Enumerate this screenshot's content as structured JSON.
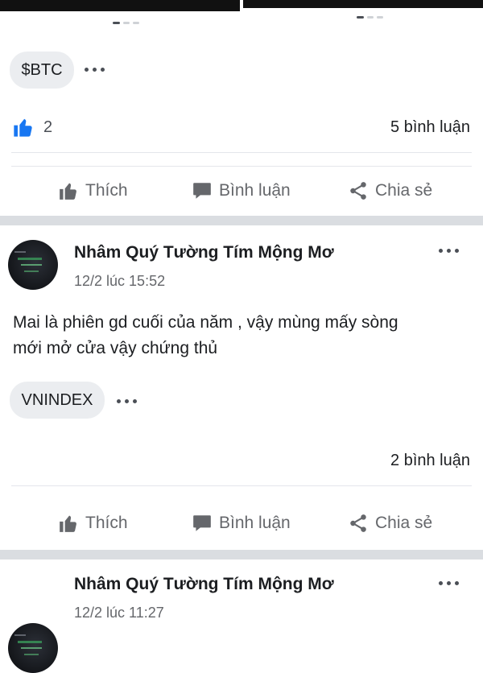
{
  "post1": {
    "tag": "$BTC",
    "like_count": "2",
    "comment_count": "5 bình luận"
  },
  "actions": {
    "like": "Thích",
    "comment": "Bình luận",
    "share": "Chia sẻ"
  },
  "post2": {
    "author": "Nhâm Quý Tường Tím Mộng Mơ",
    "timestamp": "12/2 lúc 15:52",
    "text_line1": "Mai là phiên gd cuối của năm , vậy mùng mấy sòng",
    "text_line2": "mới mở cửa vậy chứng thủ",
    "tag": "VNINDEX",
    "comment_count": "2 bình luận"
  },
  "post3": {
    "author": "Nhâm Quý Tường Tím Mộng Mơ",
    "timestamp": "12/2 lúc 11:27"
  },
  "colors": {
    "like_blue": "#1877f2",
    "icon_gray": "#65676b",
    "divider": "#dadde1"
  },
  "icons": {
    "like": "thumbs-up-icon",
    "comment": "speech-bubble-icon",
    "share": "share-icon",
    "more": "more-horizontal-icon"
  }
}
